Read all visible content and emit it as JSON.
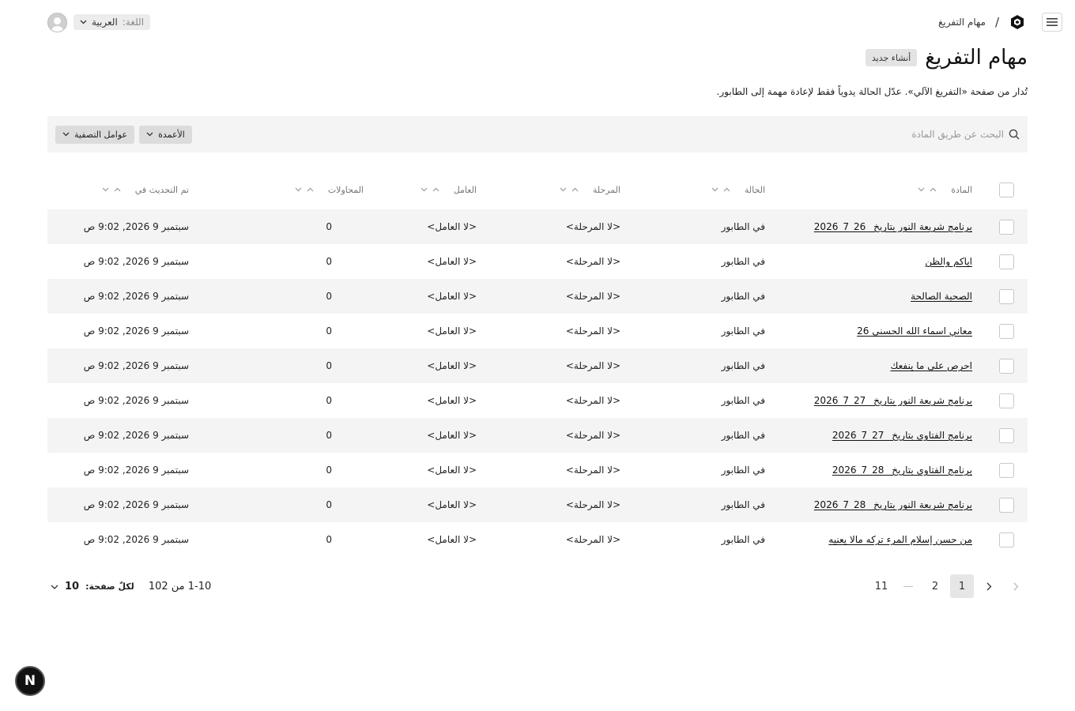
{
  "header": {
    "breadcrumb": "مهام التفريغ",
    "breadcrumb_sep": "/",
    "language_label": "اللغة:",
    "language_value": "العربية"
  },
  "page": {
    "title": "مهام التفريغ",
    "new_button": "أنشاء جديد",
    "subtitle": "تُدار من صفحة «التفريغ الآلي». عدّل الحالة يدوياً فقط لإعادة مهمة إلى الطابور."
  },
  "toolbar": {
    "search_placeholder": "البحث عن طريق المادة",
    "columns_button": "الأعمدة",
    "filters_button": "عوامل التصفية"
  },
  "table": {
    "columns": [
      "المادة",
      "الحالة",
      "المرحلة",
      "العامل",
      "المحاولات",
      "تم التحديث في"
    ],
    "rows": [
      {
        "material": "برنامج شريعة النور بتاريخ _26_7_2026",
        "status": "في الطابور",
        "stage": "<لا المرحلة>",
        "worker": "<لا العامل>",
        "attempts": "0",
        "updated": "سبتمبر 9 2026, 9:02 ص"
      },
      {
        "material": "اياكم والظن",
        "status": "في الطابور",
        "stage": "<لا المرحلة>",
        "worker": "<لا العامل>",
        "attempts": "0",
        "updated": "سبتمبر 9 2026, 9:02 ص"
      },
      {
        "material": "الصحبة الصالحة",
        "status": "في الطابور",
        "stage": "<لا المرحلة>",
        "worker": "<لا العامل>",
        "attempts": "0",
        "updated": "سبتمبر 9 2026, 9:02 ص"
      },
      {
        "material": "معاني اسماء الله الحسنى 26",
        "status": "في الطابور",
        "stage": "<لا المرحلة>",
        "worker": "<لا العامل>",
        "attempts": "0",
        "updated": "سبتمبر 9 2026, 9:02 ص"
      },
      {
        "material": "احرص على ما ينفعك",
        "status": "في الطابور",
        "stage": "<لا المرحلة>",
        "worker": "<لا العامل>",
        "attempts": "0",
        "updated": "سبتمبر 9 2026, 9:02 ص"
      },
      {
        "material": "برنامج شريعة النور بتاريخ _27_7_2026",
        "status": "في الطابور",
        "stage": "<لا المرحلة>",
        "worker": "<لا العامل>",
        "attempts": "0",
        "updated": "سبتمبر 9 2026, 9:02 ص"
      },
      {
        "material": "برنامج الفتاوى بتاريخ _27_7_2026",
        "status": "في الطابور",
        "stage": "<لا المرحلة>",
        "worker": "<لا العامل>",
        "attempts": "0",
        "updated": "سبتمبر 9 2026, 9:02 ص"
      },
      {
        "material": "برنامج الفتاوى بتاريخ _28_7_2026",
        "status": "في الطابور",
        "stage": "<لا المرحلة>",
        "worker": "<لا العامل>",
        "attempts": "0",
        "updated": "سبتمبر 9 2026, 9:02 ص"
      },
      {
        "material": "برنامج شريعة النور بتاريخ _28_7_2026",
        "status": "في الطابور",
        "stage": "<لا المرحلة>",
        "worker": "<لا العامل>",
        "attempts": "0",
        "updated": "سبتمبر 9 2026, 9:02 ص"
      },
      {
        "material": "من حسن إسلام المرء تركه مالا يعنيه",
        "status": "في الطابور",
        "stage": "<لا المرحلة>",
        "worker": "<لا العامل>",
        "attempts": "0",
        "updated": "سبتمبر 9 2026, 9:02 ص"
      }
    ]
  },
  "pagination": {
    "pages": [
      "1",
      "2",
      "—",
      "11"
    ],
    "current": "1",
    "range_text": "1-10 من 102",
    "per_page_label": "لكلّ صفحة:",
    "per_page_value": "10"
  },
  "badge": {
    "letter": "N"
  }
}
